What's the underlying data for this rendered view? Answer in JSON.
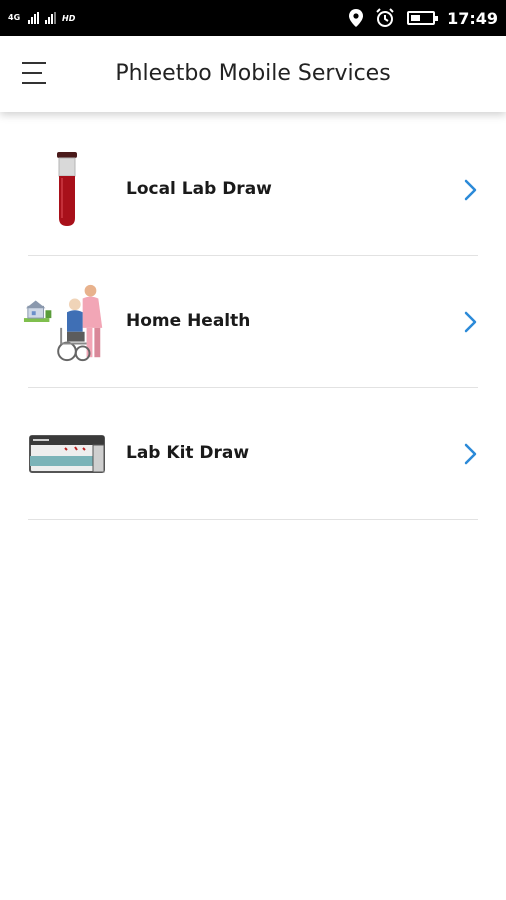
{
  "status_bar": {
    "network": "4G",
    "hd": "HD",
    "time": "17:49",
    "battery_level": 0.45
  },
  "header": {
    "title": "Phleetbo Mobile Services",
    "menu_icon": "hamburger-menu-icon"
  },
  "services": [
    {
      "label": "Local Lab Draw",
      "icon": "blood-tube-icon"
    },
    {
      "label": "Home Health",
      "icon": "caregiver-wheelchair-icon"
    },
    {
      "label": "Lab Kit Draw",
      "icon": "lab-kit-icon"
    }
  ],
  "colors": {
    "accent": "#2b8ad8",
    "status_bar": "#000000",
    "divider": "#e2e2e2"
  }
}
